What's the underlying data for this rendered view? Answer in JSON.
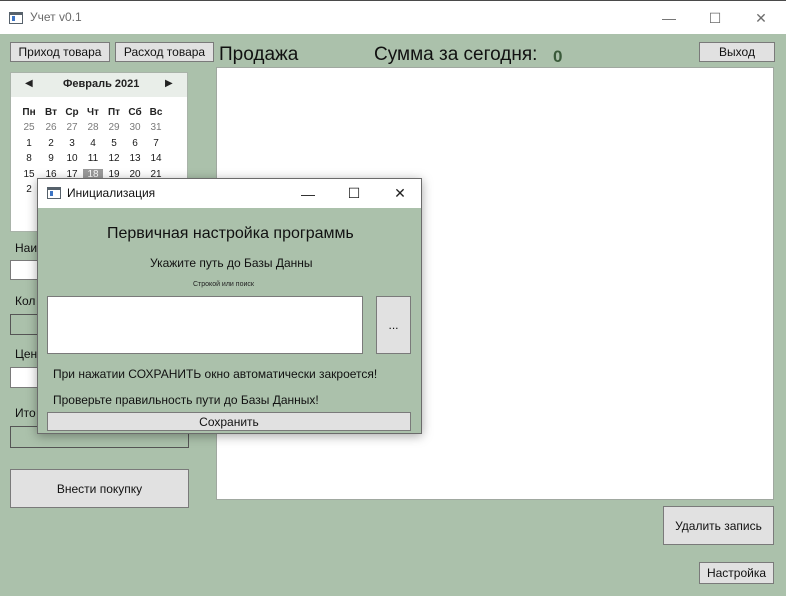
{
  "window": {
    "title": "Учет v0.1",
    "minimize_glyph": "—",
    "maximize_glyph": "☐",
    "close_glyph": "✕"
  },
  "toolbar": {
    "income_label": "Приход товара",
    "expense_label": "Расход товара",
    "sale_heading": "Продажа",
    "today_sum_label": "Сумма за сегодня:",
    "today_sum_value": "0",
    "exit_label": "Выход"
  },
  "calendar": {
    "month_label": "Февраль 2021",
    "prev_glyph": "◀",
    "next_glyph": "▶",
    "weekdays": [
      "Пн",
      "Вт",
      "Ср",
      "Чт",
      "Пт",
      "Сб",
      "Вс"
    ],
    "rows": [
      [
        "25",
        "26",
        "27",
        "28",
        "29",
        "30",
        "31"
      ],
      [
        "1",
        "2",
        "3",
        "4",
        "5",
        "6",
        "7"
      ],
      [
        "8",
        "9",
        "10",
        "11",
        "12",
        "13",
        "14"
      ],
      [
        "15",
        "16",
        "17",
        "18",
        "19",
        "20",
        "21"
      ],
      [
        "2"
      ]
    ],
    "selected_day": "18"
  },
  "form": {
    "name_label": "Наи",
    "qty_label": "Кол",
    "price_label": "Цен",
    "total_label": "Ито",
    "add_purchase_label": "Внести покупку"
  },
  "actions": {
    "delete_record_label": "Удалить запись",
    "settings_label": "Настройка"
  },
  "dialog": {
    "title": "Инициализация",
    "minimize_glyph": "—",
    "maximize_glyph": "☐",
    "close_glyph": "✕",
    "heading": "Первичная настройка программы",
    "subheading": "Укажите путь до Базы Данны",
    "hint": "Строкой или поиск",
    "path_value": "",
    "browse_label": "...",
    "note1": "При нажатии СОХРАНИТЬ окно автоматически закроется!",
    "note2": "Проверьте правильность пути до Базы Данных!",
    "save_label": "Сохранить"
  }
}
